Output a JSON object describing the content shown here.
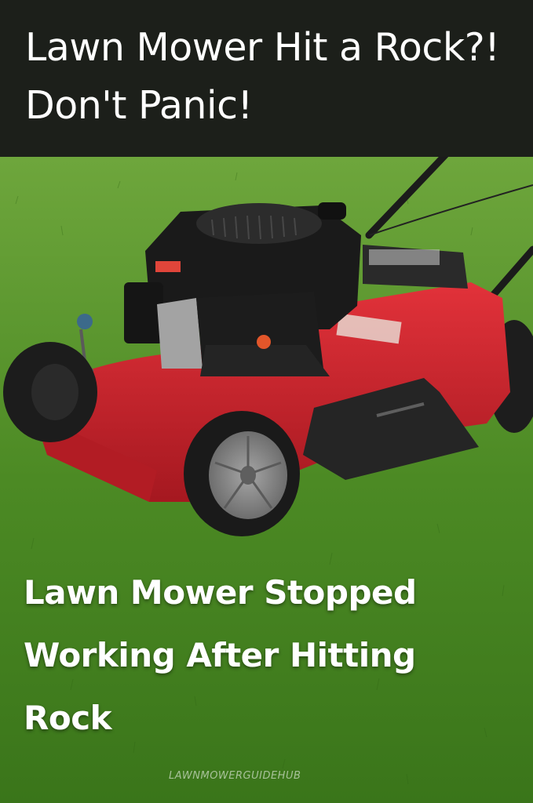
{
  "header": {
    "title": "Lawn Mower Hit a Rock?! Don't Panic!"
  },
  "caption": {
    "text": "Lawn Mower Stopped Working After Hitting Rock"
  },
  "watermark": {
    "text": "LAWNMOWERGUIDEHUB"
  },
  "colors": {
    "header_background": "#1c1f1a",
    "grass": "#4f8f2a",
    "mower_deck": "#c8202b",
    "engine": "#1a1a1a"
  }
}
